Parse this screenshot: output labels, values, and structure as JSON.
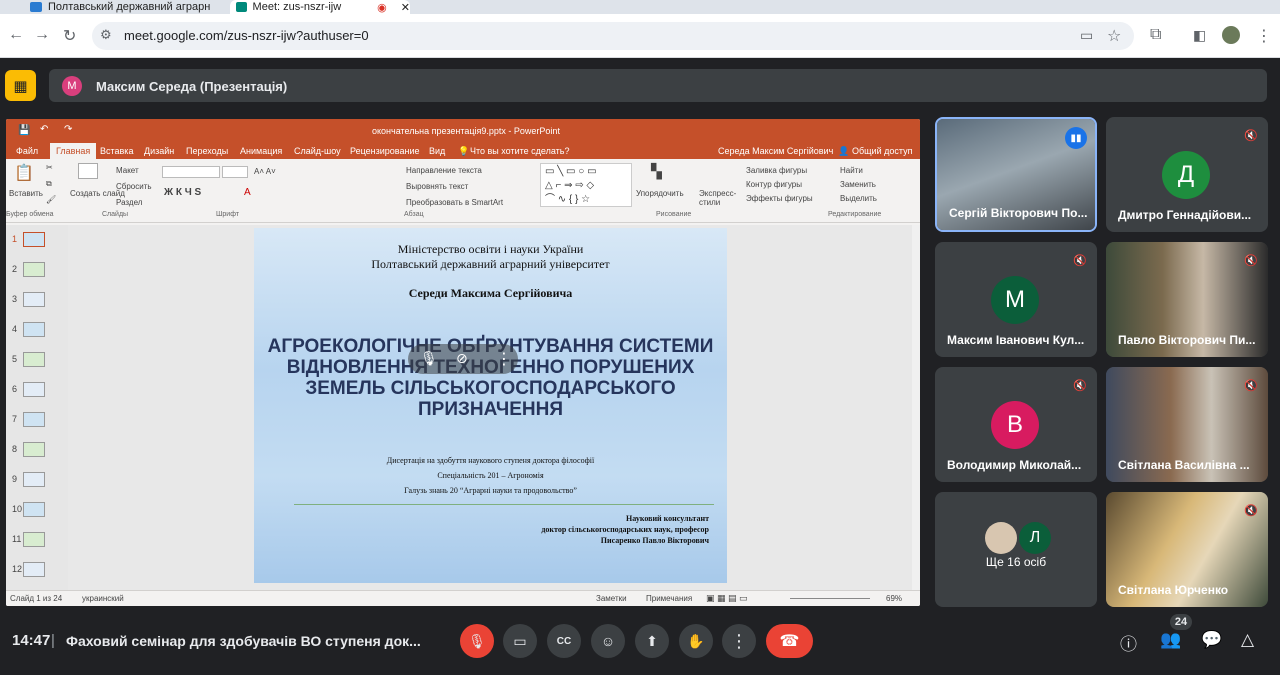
{
  "browser": {
    "tabs": [
      {
        "label": "Полтавський державний аграрн",
        "active": false
      },
      {
        "label": "Meet: zus-nszr-ijw",
        "active": true
      }
    ],
    "url": "meet.google.com/zus-nszr-ijw?authuser=0"
  },
  "presentation": {
    "presenter_initial": "М",
    "presenter_label": "Максим Середа (Презентація)"
  },
  "powerpoint": {
    "title": "окончательна презентація9.pptx - PowerPoint",
    "tabs": [
      "Файл",
      "Главная",
      "Вставка",
      "Дизайн",
      "Переходы",
      "Анимация",
      "Слайд-шоу",
      "Рецензирование",
      "Вид"
    ],
    "tell_me": "Что вы хотите сделать?",
    "user": "Середа Максим Сергійович",
    "share": "Общий доступ",
    "ribbon": {
      "paste": "Вставить",
      "create_slide": "Создать слайд",
      "layout": "Макет",
      "reset": "Сбросить",
      "section": "Раздел",
      "text_direction": "Направление текста",
      "align_text": "Выровнять текст",
      "smartart": "Преобразовать в SmartArt",
      "arrange": "Упорядочить",
      "quick_styles": "Экспресс-стили",
      "shape_fill": "Заливка фигуры",
      "shape_outline": "Контур фигуры",
      "shape_effects": "Эффекты фигуры",
      "find": "Найти",
      "replace": "Заменить",
      "select": "Выделить",
      "groups": [
        "Буфер обмена",
        "Слайды",
        "Шрифт",
        "Абзац",
        "Рисование",
        "Редактирование"
      ]
    },
    "thumbnails": [
      "1",
      "2",
      "3",
      "4",
      "5",
      "6",
      "7",
      "8",
      "9",
      "10",
      "11",
      "12"
    ],
    "status": {
      "slide": "Слайд 1 из 24",
      "language": "украинский",
      "notes": "Заметки",
      "comments": "Примечания",
      "zoom": "69%"
    }
  },
  "slide": {
    "ministry": "Міністерство освіти і науки України",
    "university": "Полтавський державний аграрний університет",
    "author": "Середи Максима Сергійовича",
    "heading": "АГРОЕКОЛОГІЧНЕ ОБҐРУНТУВАННЯ СИСТЕМИ ВІДНОВЛЕННЯ ТЕХНОГЕННО ПОРУШЕНИХ ЗЕМЕЛЬ СІЛЬСЬКОГОСПОДАРСЬКОГО ПРИЗНАЧЕННЯ",
    "line1": "Дисертація на здобуття наукового ступеня доктора філософії",
    "line2": "Спеціальність 201 – Агрономія",
    "line3": "Галузь знань 20 “Аграрні науки та продовольство”",
    "consultant_title": "Науковий консультант",
    "consultant_degree": "доктор сільськогосподарських наук, професор",
    "consultant_name": "Писаренко Павло Вікторович"
  },
  "participants": [
    {
      "name": "Сергій Вікторович По...",
      "initial": "",
      "color": "",
      "video": true
    },
    {
      "name": "Дмитро Геннадійови...",
      "initial": "Д",
      "color": "#1e8e3e",
      "video": false
    },
    {
      "name": "Максим Іванович Кул...",
      "initial": "М",
      "color": "#0b5e3a",
      "video": false
    },
    {
      "name": "Павло Вікторович Пи...",
      "initial": "",
      "color": "",
      "video": true
    },
    {
      "name": "Володимир Миколай...",
      "initial": "В",
      "color": "#d81b60",
      "video": false
    },
    {
      "name": "Світлана Василівна ...",
      "initial": "",
      "color": "",
      "video": true
    },
    {
      "name": "Ще 16 осіб",
      "initial": "Л",
      "color": "#0b5e3a",
      "video": false
    },
    {
      "name": "Світлана Юрченко",
      "initial": "",
      "color": "",
      "video": true
    }
  ],
  "bottom": {
    "time": "14:47",
    "separator": "|",
    "meeting_title": "Фаховий семінар для здобувачів ВО ступеня док...",
    "participant_count": "24"
  }
}
